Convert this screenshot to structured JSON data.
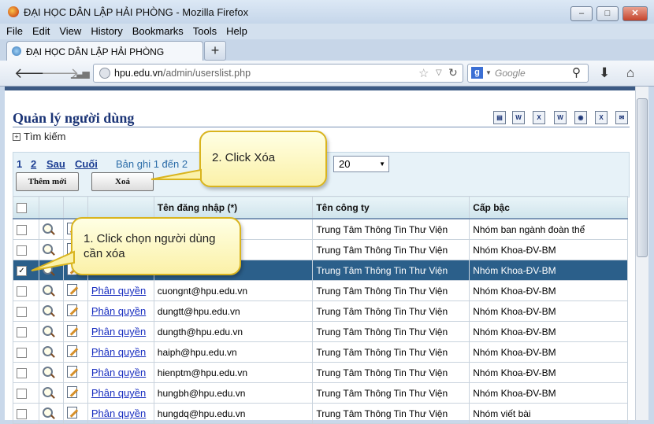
{
  "window": {
    "title": "ĐẠI HỌC DÂN LẬP HẢI PHÒNG - Mozilla Firefox",
    "minimize": "–",
    "maximize": "□",
    "close": "✕"
  },
  "menu": [
    "File",
    "Edit",
    "View",
    "History",
    "Bookmarks",
    "Tools",
    "Help"
  ],
  "tab": {
    "label": "ĐẠI HỌC DÂN LẬP HẢI PHÒNG",
    "new_tab": "+"
  },
  "address": {
    "host": "hpu.edu.vn",
    "path": "/admin/userslist.php"
  },
  "search": {
    "engine": "g",
    "placeholder": "Google"
  },
  "page": {
    "title": "Quản lý người dùng",
    "search_toggle": "Tìm kiếm",
    "export_icons": [
      "printer-icon",
      "word-icon",
      "excel-icon",
      "word2-icon",
      "html-icon",
      "xml-icon",
      "email-icon"
    ],
    "pager": {
      "page1": "1",
      "page2": "2",
      "next": "Sau",
      "last": "Cuối",
      "record_info": "Bản ghi 1 đến 2",
      "record_suffix": "i",
      "per_page": "20"
    },
    "buttons": {
      "add": "Thêm mới",
      "delete": "Xoá"
    }
  },
  "table": {
    "headers": [
      "",
      "",
      "",
      "",
      "Tên đăng nhập (*)",
      "Tên công ty",
      "Cấp bậc"
    ],
    "rows": [
      {
        "checked": false,
        "perm": "",
        "login": "",
        "company": "Trung Tâm Thông Tin Thư Viện",
        "rank": "Nhóm ban ngành đoàn thể"
      },
      {
        "checked": false,
        "perm": "",
        "login": "",
        "company": "Trung Tâm Thông Tin Thư Viện",
        "rank": "Nhóm Khoa-ĐV-BM"
      },
      {
        "checked": true,
        "perm": "",
        "login": "n",
        "company": "Trung Tâm Thông Tin Thư Viện",
        "rank": "Nhóm Khoa-ĐV-BM"
      },
      {
        "checked": false,
        "perm": "Phân quyền",
        "login": "cuongnt@hpu.edu.vn",
        "company": "Trung Tâm Thông Tin Thư Viện",
        "rank": "Nhóm Khoa-ĐV-BM"
      },
      {
        "checked": false,
        "perm": "Phân quyền",
        "login": "dungtt@hpu.edu.vn",
        "company": "Trung Tâm Thông Tin Thư Viện",
        "rank": "Nhóm Khoa-ĐV-BM"
      },
      {
        "checked": false,
        "perm": "Phân quyền",
        "login": "dungth@hpu.edu.vn",
        "company": "Trung Tâm Thông Tin Thư Viện",
        "rank": "Nhóm Khoa-ĐV-BM"
      },
      {
        "checked": false,
        "perm": "Phân quyền",
        "login": "haiph@hpu.edu.vn",
        "company": "Trung Tâm Thông Tin Thư Viện",
        "rank": "Nhóm Khoa-ĐV-BM"
      },
      {
        "checked": false,
        "perm": "Phân quyền",
        "login": "hienptm@hpu.edu.vn",
        "company": "Trung Tâm Thông Tin Thư Viện",
        "rank": "Nhóm Khoa-ĐV-BM"
      },
      {
        "checked": false,
        "perm": "Phân quyền",
        "login": "hungbh@hpu.edu.vn",
        "company": "Trung Tâm Thông Tin Thư Viện",
        "rank": "Nhóm Khoa-ĐV-BM"
      },
      {
        "checked": false,
        "perm": "Phân quyền",
        "login": "hungdq@hpu.edu.vn",
        "company": "Trung Tâm Thông Tin Thư Viện",
        "rank": "Nhóm viết bài"
      }
    ]
  },
  "callouts": {
    "click_delete": "2. Click Xóa",
    "click_select": "1. Click chọn người dùng cần xóa"
  },
  "colors": {
    "selected_row": "#2b5f8a",
    "title": "#1b3476",
    "callout_border": "#d9b41e"
  }
}
